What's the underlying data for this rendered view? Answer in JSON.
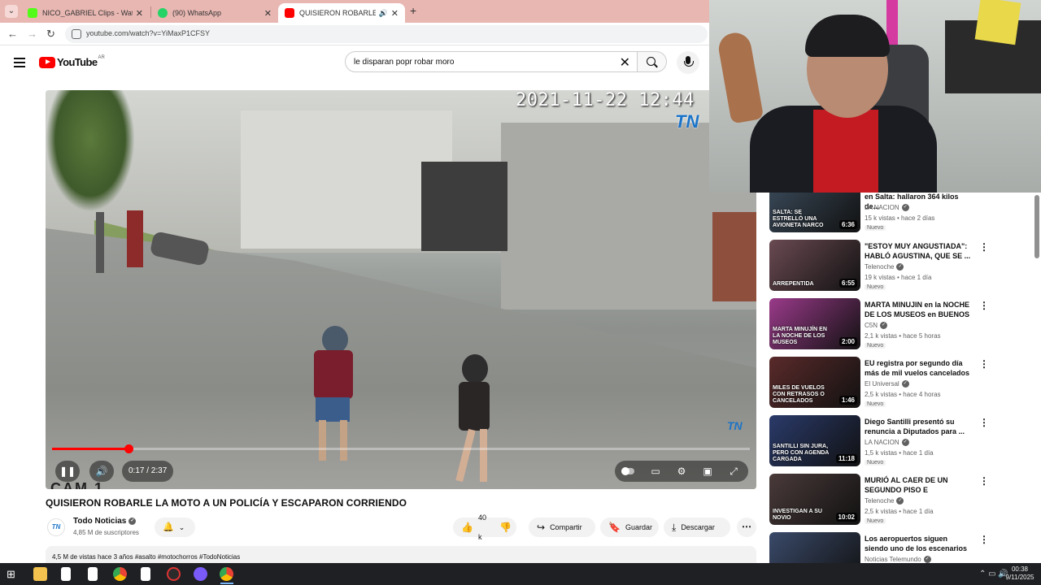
{
  "browser": {
    "tabs": [
      {
        "title": "NICO_GABRIEL Clips - Watch Liv",
        "favicon_color": "#53fc18",
        "active": false
      },
      {
        "title": "(90) WhatsApp",
        "favicon_color": "#25d366",
        "active": false
      },
      {
        "title": "QUISIERON ROBARLE LA M",
        "favicon_color": "#ff0000",
        "active": true
      }
    ],
    "url": "youtube.com/watch?v=YiMaxP1CFSY"
  },
  "header": {
    "logo_text": "YouTube",
    "country": "AR",
    "search_value": "le disparan popr robar moro"
  },
  "video": {
    "overlay_timestamp": "2021-11-22 12:44",
    "watermark": "TN",
    "bottom_watermark": "CAM 1",
    "current_time": "0:17",
    "duration": "2:37",
    "time_display": "0:17 / 2:37",
    "progress_fraction": 0.11,
    "title": "QUISIERON ROBARLE LA MOTO A UN POLICÍA Y ESCAPARON CORRIENDO"
  },
  "channel": {
    "name": "Todo Noticias",
    "logo_text": "TN",
    "subscribers": "4,85 M de suscriptores"
  },
  "actions": {
    "likes": "40 k",
    "share": "Compartir",
    "save": "Guardar",
    "download": "Descargar"
  },
  "description": {
    "text": "4,5 M de vistas  hace 3 años  #asalto #motochorros #TodoNoticias"
  },
  "recommendations": [
    {
      "title": "en Salta: hallaron 364 kilos de...",
      "channel": "LA NACION",
      "meta": "15 k vistas • hace 2 días",
      "badge": "Nuevo",
      "duration": "6:36",
      "caption": "SALTA: SE ESTRELLÓ UNA AVIONETA NARCO",
      "thumb_color": "#3a4a5a"
    },
    {
      "title": "\"ESTOY MUY ANGUSTIADA\": HABLÓ AGUSTINA, QUE SE ...",
      "channel": "Telenoche",
      "meta": "19 k vistas • hace 1 día",
      "badge": "Nuevo",
      "duration": "6:55",
      "caption": "ARREPENTIDA",
      "thumb_color": "#6a4a52"
    },
    {
      "title": "MARTA MINUJIN en la NOCHE DE LOS MUSEOS en BUENOS ...",
      "channel": "C5N",
      "meta": "2,1 k vistas • hace 5 horas",
      "badge": "Nuevo",
      "duration": "2:00",
      "caption": "MARTA MINUJÍN EN LA NOCHE DE LOS MUSEOS",
      "thumb_color": "#9a3a8a"
    },
    {
      "title": "EU registra por segundo día más de mil vuelos cancelados",
      "channel": "El Universal",
      "meta": "2,5 k vistas • hace 4 horas",
      "badge": "Nuevo",
      "duration": "1:46",
      "caption": "MILES DE VUELOS CON RETRASOS O CANCELADOS",
      "thumb_color": "#5a2a2a"
    },
    {
      "title": "Diego Santilli presentó su renuncia a Diputados para ...",
      "channel": "LA NACION",
      "meta": "1,5 k vistas • hace 1 día",
      "badge": "Nuevo",
      "duration": "11:18",
      "caption": "SANTILLI SIN JURA, PERO CON AGENDA CARGADA",
      "thumb_color": "#2a3a6a"
    },
    {
      "title": "MURIÓ AL CAER DE UN SEGUNDO PISO E INVESTIGA...",
      "channel": "Telenoche",
      "meta": "2,5 k vistas • hace 1 día",
      "badge": "Nuevo",
      "duration": "10:02",
      "caption": "INVESTIGAN A SU NOVIO",
      "thumb_color": "#4a3a3a"
    },
    {
      "title": "Los aeropuertos siguen siendo uno de los escenarios más ...",
      "channel": "Noticias Telemundo",
      "meta": "",
      "badge": "",
      "duration": "",
      "caption": "",
      "thumb_color": "#3a4a6a"
    }
  ],
  "taskbar": {
    "time": "00:38",
    "date": "9/11/2025"
  }
}
